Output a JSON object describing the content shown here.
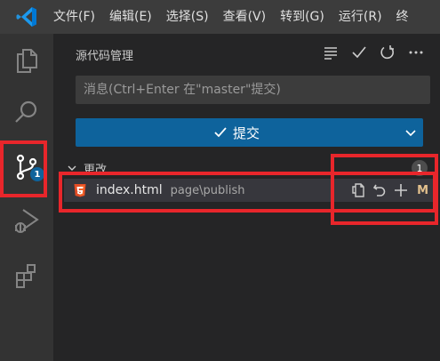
{
  "menu": {
    "items": [
      "文件(F)",
      "编辑(E)",
      "选择(S)",
      "查看(V)",
      "转到(G)",
      "运行(R)",
      "终"
    ]
  },
  "activity_bar": {
    "items": [
      {
        "name": "explorer",
        "icon": "files-icon"
      },
      {
        "name": "search",
        "icon": "search-icon"
      },
      {
        "name": "source-control",
        "icon": "source-control-icon",
        "badge": "1",
        "active": true
      },
      {
        "name": "run-debug",
        "icon": "run-debug-icon"
      },
      {
        "name": "extensions",
        "icon": "extensions-icon"
      }
    ]
  },
  "scm": {
    "title": "源代码管理",
    "actions": [
      "list-icon",
      "check-icon",
      "refresh-icon",
      "more-icon"
    ],
    "message_placeholder": "消息(Ctrl+Enter 在\"master\"提交)",
    "commit_label": "提交",
    "section_title": "更改",
    "section_count": "1",
    "files": [
      {
        "name": "index.html",
        "path": "page\\publish",
        "status": "M",
        "actions": [
          "open-file-icon",
          "discard-icon",
          "stage-icon"
        ]
      }
    ]
  },
  "colors": {
    "accent": "#0e639c",
    "annotation": "#e8262b",
    "modified": "#e2c08d",
    "html_icon": "#e44d26"
  }
}
